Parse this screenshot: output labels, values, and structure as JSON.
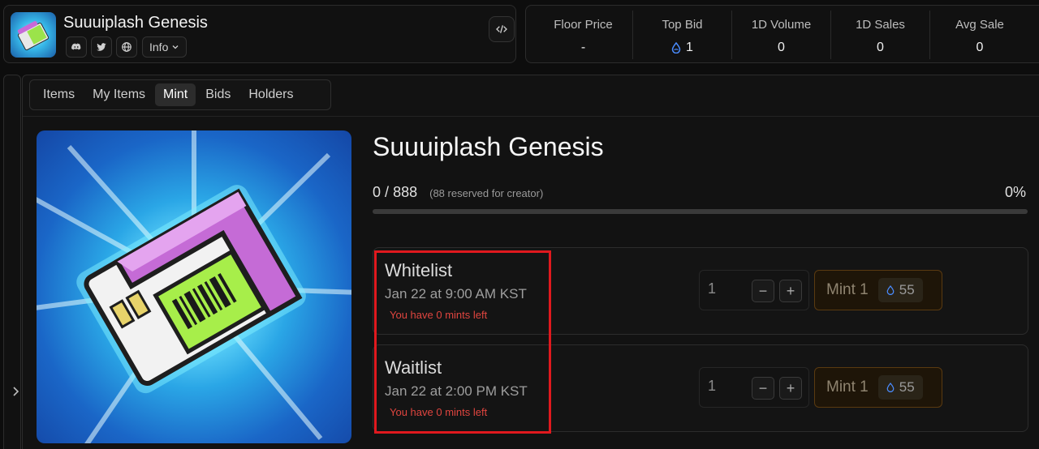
{
  "collection": {
    "name": "Suuuiplash Genesis",
    "info_label": "Info"
  },
  "stats": [
    {
      "label": "Floor Price",
      "value": "-"
    },
    {
      "label": "Top Bid",
      "value": "1"
    },
    {
      "label": "1D Volume",
      "value": "0"
    },
    {
      "label": "1D Sales",
      "value": "0"
    },
    {
      "label": "Avg Sale",
      "value": "0"
    }
  ],
  "tabs": [
    "Items",
    "My Items",
    "Mint",
    "Bids",
    "Holders"
  ],
  "active_tab": "Mint",
  "mint": {
    "title": "Suuuiplash Genesis",
    "minted": "0",
    "separator": "/",
    "total": "888",
    "reserved_note": "(88 reserved for creator)",
    "percent": "0%",
    "progress_fraction": 0,
    "phases": [
      {
        "name": "Whitelist",
        "time": "Jan 22 at 9:00 AM KST",
        "note": "You have 0 mints left",
        "qty": "1",
        "mint_label": "Mint 1",
        "price": "55"
      },
      {
        "name": "Waitlist",
        "time": "Jan 22 at 2:00 PM KST",
        "note": "You have 0 mints left",
        "qty": "1",
        "mint_label": "Mint 1",
        "price": "55"
      }
    ]
  },
  "colors": {
    "accent_blue": "#4a8cff",
    "warning_red": "#e0453f",
    "highlight_box": "#e0191e"
  }
}
